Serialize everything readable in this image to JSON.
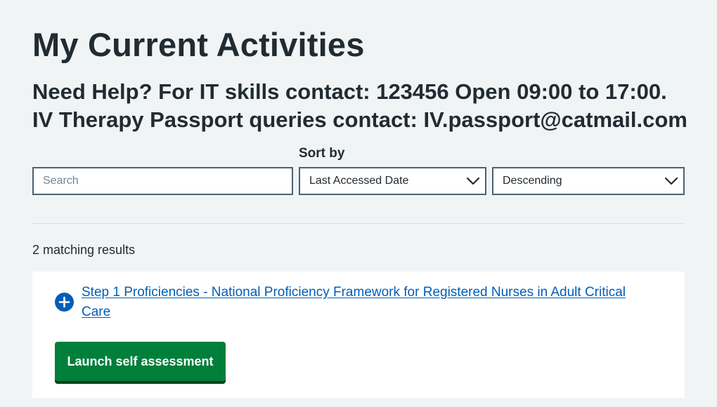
{
  "page": {
    "title": "My Current Activities",
    "help_line1": "Need Help? For IT skills contact: 123456 Open 09:00 to 17:00.",
    "help_line2": "IV Therapy Passport queries contact: IV.passport@catmail.com"
  },
  "filters": {
    "search_placeholder": "Search",
    "search_value": "",
    "sort_label": "Sort by",
    "sort_field_selected": "Last Accessed Date",
    "sort_order_selected": "Descending"
  },
  "results": {
    "count_text": "2 matching results"
  },
  "activity": {
    "title": "Step 1 Proficiencies - National Proficiency Framework for Registered Nurses in Adult Critical Care",
    "launch_label": "Launch self assessment",
    "icon": "plus-circle-icon"
  },
  "colors": {
    "background": "#f0f4f5",
    "link": "#005eb8",
    "button": "#007f3b",
    "button_shadow": "#00401e",
    "text": "#212b32"
  }
}
